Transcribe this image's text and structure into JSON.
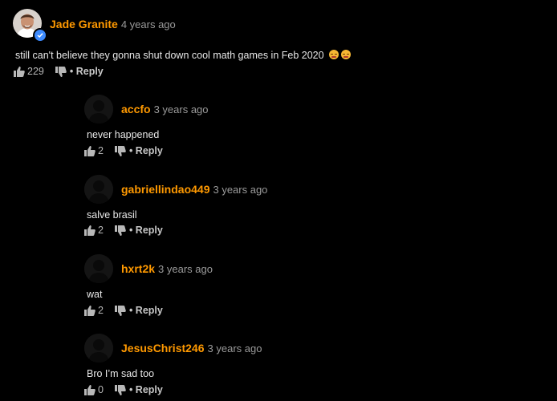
{
  "comments": [
    {
      "username": "Jade Granite",
      "time": "4 years ago",
      "text": "still can't believe they gonna shut down cool math games in Feb 2020",
      "likes": "229",
      "reply_label": "• Reply",
      "verified": true,
      "emojis": [
        "sleepy-face",
        "sleepy-face"
      ]
    },
    {
      "username": "accfo",
      "time": "3 years ago",
      "text": "never happened",
      "likes": "2",
      "reply_label": "• Reply"
    },
    {
      "username": "gabriellindao449",
      "time": "3 years ago",
      "text": "salve brasil",
      "likes": "2",
      "reply_label": "• Reply"
    },
    {
      "username": "hxrt2k",
      "time": "3 years ago",
      "text": "wat",
      "likes": "2",
      "reply_label": "• Reply"
    },
    {
      "username": "JesusChrist246",
      "time": "3 years ago",
      "text": "Bro I’m sad too",
      "likes": "0",
      "reply_label": "• Reply"
    }
  ],
  "colors": {
    "background": "#000000",
    "username": "#ff9900",
    "timestamp": "#9a9a9a",
    "verified": "#3d8bff"
  }
}
